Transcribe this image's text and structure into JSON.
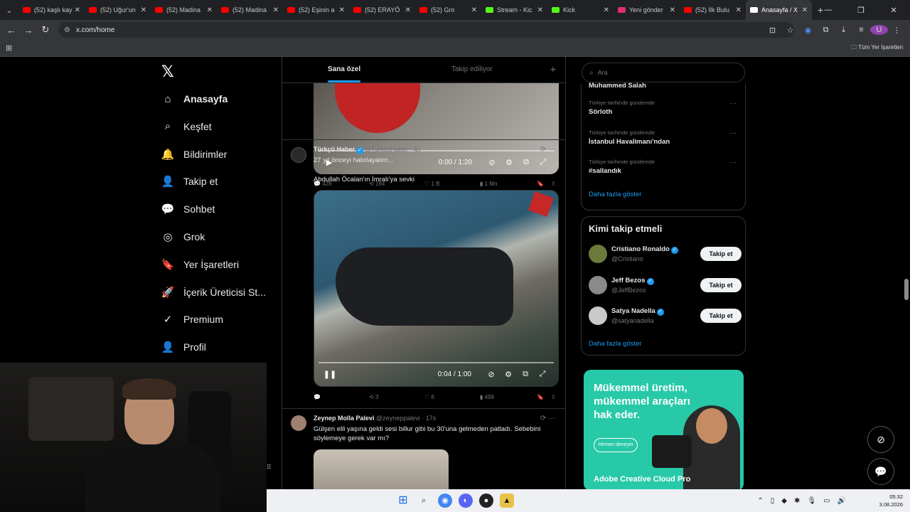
{
  "browser": {
    "tabs": [
      {
        "title": "(52) kaşlı kay",
        "color": "#ff0000"
      },
      {
        "title": "(52) Uğur'un",
        "color": "#ff0000"
      },
      {
        "title": "(52) Madina",
        "color": "#ff0000"
      },
      {
        "title": "(52) Madina",
        "color": "#ff0000"
      },
      {
        "title": "(52) Eşinin a",
        "color": "#ff0000"
      },
      {
        "title": "(52) ERAYÖ",
        "color": "#ff0000"
      },
      {
        "title": "(52) Gro",
        "color": "#ff0000"
      },
      {
        "title": "Stream - Kic",
        "color": "#53fc18"
      },
      {
        "title": "Kick",
        "color": "#53fc18"
      },
      {
        "title": "Yeni gönder",
        "color": "#e1306c"
      },
      {
        "title": "(52) İlk Bulu",
        "color": "#ff0000"
      },
      {
        "title": "Anasayfa / X",
        "color": "#ffffff"
      }
    ],
    "url": "x.com/home",
    "bookmarks_all": "Tüm Yer İşaretleri",
    "profile_initial": "U"
  },
  "sidebar": {
    "items": [
      {
        "label": "Anasayfa",
        "icon": "⌂"
      },
      {
        "label": "Keşfet",
        "icon": "⌕"
      },
      {
        "label": "Bildirimler",
        "icon": "🔔"
      },
      {
        "label": "Takip et",
        "icon": "👤"
      },
      {
        "label": "Sohbet",
        "icon": "💬"
      },
      {
        "label": "Grok",
        "icon": "◎"
      },
      {
        "label": "Yer İşaretleri",
        "icon": "🔖"
      },
      {
        "label": "İçerik Üreticisi St...",
        "icon": "🚀"
      },
      {
        "label": "Premium",
        "icon": "✓"
      },
      {
        "label": "Profil",
        "icon": "👤"
      }
    ]
  },
  "feed": {
    "tab_foryou": "Sana özel",
    "tab_following": "Takip ediliyor",
    "post1": {
      "time": "0:00 / 1:20",
      "replies": "428",
      "reposts": "194",
      "likes": "1 B",
      "views": "1 Mn"
    },
    "post2": {
      "name": "Türkçü Haber",
      "handle": "@TurkcuHaber · 4s",
      "line1": "27 yıl önceyi hatırlayalım...",
      "line2": "Abdullah Öcalan'ın İmralı'ya sevki",
      "time": "0:04 / 1:00",
      "replies": "",
      "reposts": "3",
      "likes": "6",
      "views": "499"
    },
    "post3": {
      "name": "Zeynep Molla Palevi",
      "handle": "@zeyneppalevi · 17s",
      "text1": "Gülşen elli yaşına geldi sesi billur gibi bu 30'una gelmeden patladı. Sebebini",
      "text2": "söylemeye gerek var mı?"
    }
  },
  "right": {
    "search_placeholder": "Ara",
    "partial_trend": "Muhammed Salah",
    "trends": [
      {
        "category": "Türkiye tarihinde gündemde",
        "name": "Sörloth"
      },
      {
        "category": "Türkiye tarihinde gündemde",
        "name": "İstanbul Havalimanı'ndan"
      },
      {
        "category": "Türkiye tarihinde gündemde",
        "name": "#sallandık"
      }
    ],
    "show_more": "Daha fazla göster",
    "who_title": "Kimi takip etmeli",
    "who": [
      {
        "name": "Cristiano Ronaldo",
        "handle": "@Cristiano",
        "button": "Takip et",
        "avatar_color": "#6b7a3a"
      },
      {
        "name": "Jeff Bezos",
        "handle": "@JeffBezos",
        "button": "Takip et",
        "avatar_color": "#8a8a8a"
      },
      {
        "name": "Satya Nadella",
        "handle": "@satyanadella",
        "button": "Takip et",
        "avatar_color": "#c9c9c9"
      }
    ],
    "who_more": "Daha fazla göster",
    "ad": {
      "headline": "Mükemmel üretim, mükemmel araçları hak eder.",
      "button": "Hemen deneyin",
      "brand": "Adobe Creative Cloud Pro"
    }
  },
  "taskbar": {
    "clock_time": "05:32",
    "clock_date": "3.08.2026"
  }
}
